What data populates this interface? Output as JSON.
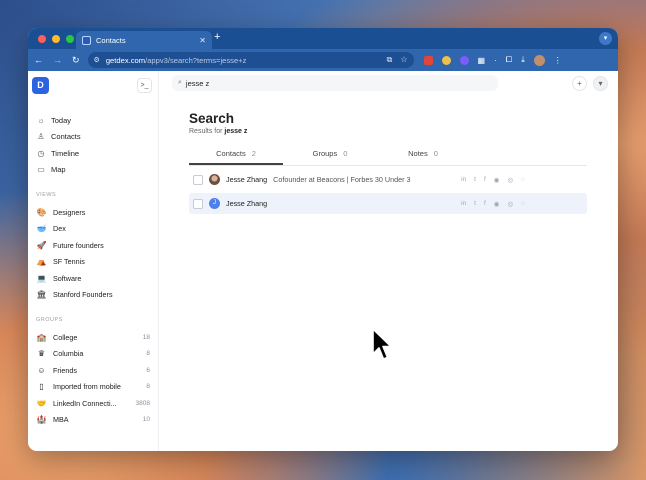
{
  "browser": {
    "tab_title": "Contacts",
    "url_host": "getdex.com",
    "url_path": "/appv3/search?terms=jesse+z"
  },
  "sidebar": {
    "nav": [
      {
        "label": "Today",
        "icon": "sun-icon"
      },
      {
        "label": "Contacts",
        "icon": "person-icon"
      },
      {
        "label": "Timeline",
        "icon": "clock-icon"
      },
      {
        "label": "Map",
        "icon": "map-icon"
      }
    ],
    "views_label": "VIEWS",
    "views": [
      {
        "label": "Designers",
        "icon": "palette-icon"
      },
      {
        "label": "Dex",
        "icon": "bowl-icon"
      },
      {
        "label": "Future founders",
        "icon": "rocket-icon"
      },
      {
        "label": "SF Tennis",
        "icon": "tent-icon"
      },
      {
        "label": "Software",
        "icon": "laptop-icon"
      },
      {
        "label": "Stanford Founders",
        "icon": "building-icon"
      }
    ],
    "groups_label": "GROUPS",
    "groups": [
      {
        "label": "College",
        "count": "18",
        "icon": "school-icon"
      },
      {
        "label": "Columbia",
        "count": "8",
        "icon": "crown-icon"
      },
      {
        "label": "Friends",
        "count": "6",
        "icon": "smile-icon"
      },
      {
        "label": "Imported from mobile",
        "count": "8",
        "icon": "phone-icon"
      },
      {
        "label": "LinkedIn Connecti...",
        "count": "3808",
        "icon": "handshake-icon"
      },
      {
        "label": "MBA",
        "count": "10",
        "icon": "mba-icon"
      }
    ]
  },
  "search": {
    "value": "jesse z"
  },
  "page": {
    "title": "Search",
    "results_prefix": "Results for",
    "query": "jesse z"
  },
  "tabs": [
    {
      "label": "Contacts",
      "count": "2"
    },
    {
      "label": "Groups",
      "count": "0"
    },
    {
      "label": "Notes",
      "count": "0"
    }
  ],
  "results": [
    {
      "name": "Jesse Zhang",
      "title": "Cofounder at Beacons | Forbes 30 Under 3",
      "avatar": "photo"
    },
    {
      "name": "Jesse Zhang",
      "title": "",
      "avatar": "J"
    }
  ],
  "social_icons": [
    "in",
    "tw",
    "f",
    "ms",
    "ig",
    "wa"
  ]
}
